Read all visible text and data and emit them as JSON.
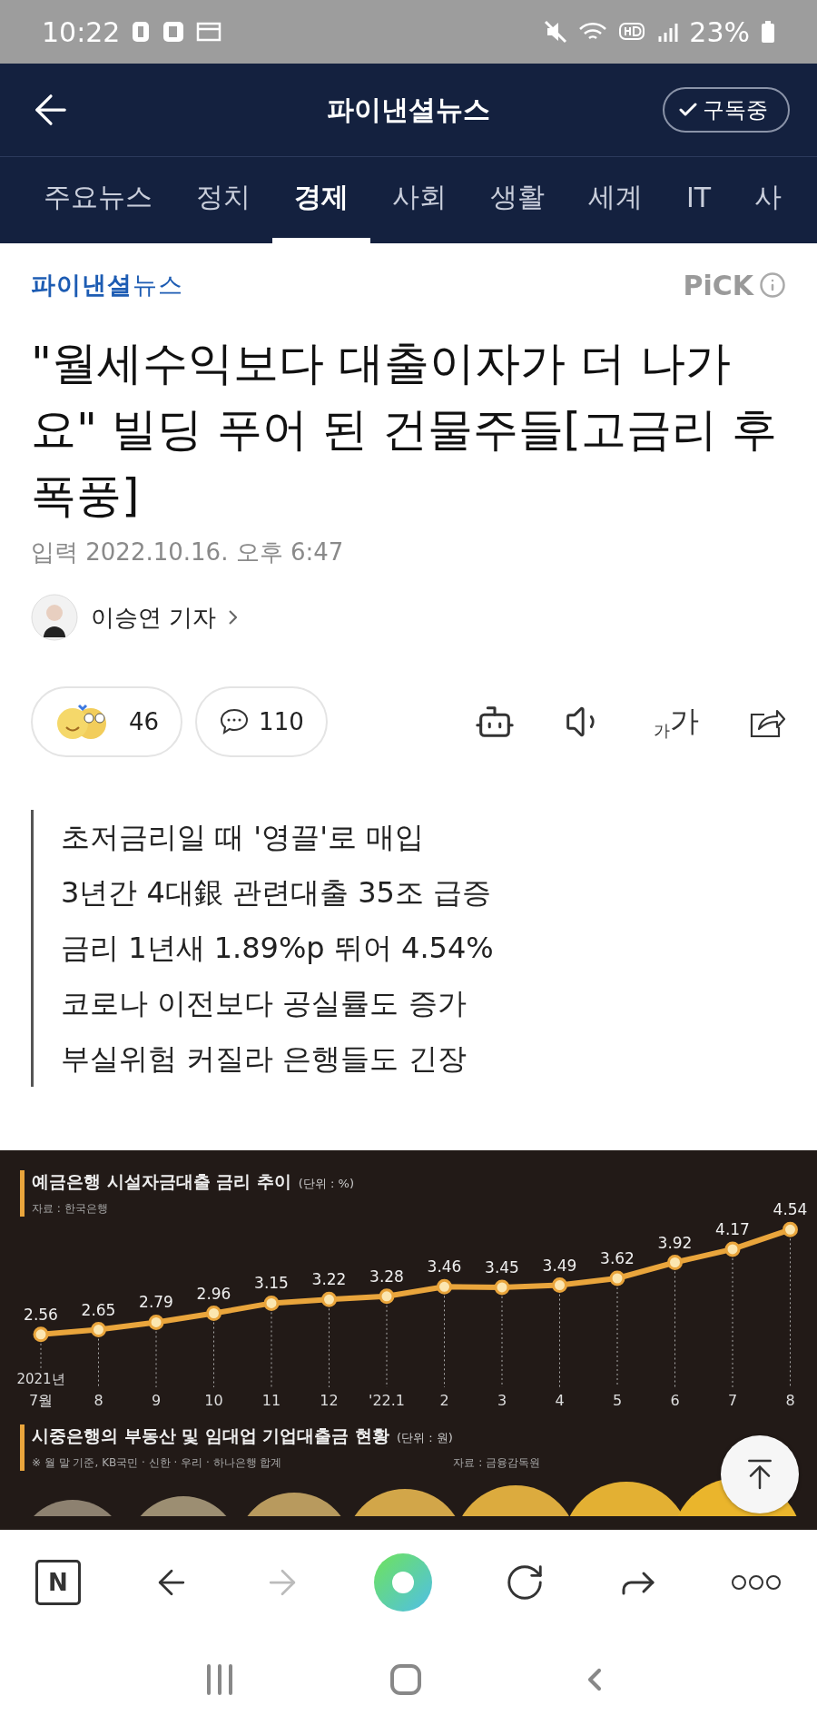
{
  "status_bar": {
    "time": "10:22",
    "battery": "23%"
  },
  "header": {
    "title": "파이낸셜뉴스",
    "subscribe": {
      "label": "구독중",
      "subscribed": true
    }
  },
  "tabs": [
    {
      "label": "주요뉴스",
      "selected": false
    },
    {
      "label": "정치",
      "selected": false
    },
    {
      "label": "경제",
      "selected": true
    },
    {
      "label": "사회",
      "selected": false
    },
    {
      "label": "생활",
      "selected": false
    },
    {
      "label": "세계",
      "selected": false
    },
    {
      "label": "IT",
      "selected": false
    },
    {
      "label": "사",
      "selected": false
    }
  ],
  "article": {
    "press_logo": "**파이낸셜**뉴스",
    "pick": "PiCK",
    "title": "\"월세수익보다 대출이자가 더 나가요\" 빌딩 푸어 된 건물주들[고금리 후폭풍]",
    "date": "입력 2022.10.16. 오후 6:47",
    "author": "이승연 기자",
    "reactions": "46",
    "comments": "110",
    "font_button": [
      "가",
      "가"
    ],
    "summary": [
      "초저금리일 때 '영끌'로 매입",
      "3년간 4대銀 관련대출 35조 급증",
      "금리 1년새 1.89%p 뛰어 4.54%",
      "코로나 이전보다 공실률도 증가",
      "부실위험 커질라 은행들도 긴장"
    ]
  },
  "infographic": {
    "title": "예금은행 시설자금대출 금리 추이",
    "unit": "(단위 : %)",
    "source": "자료 : 한국은행",
    "year_label": "2021년",
    "chart_data": {
      "type": "line",
      "categories": [
        "7월",
        "8",
        "9",
        "10",
        "11",
        "12",
        "'22.1",
        "2",
        "3",
        "4",
        "5",
        "6",
        "7",
        "8"
      ],
      "series": [
        {
          "color": "#e9a53c",
          "marker": "circle",
          "values": [
            2.56,
            2.65,
            2.79,
            2.96,
            3.15,
            3.22,
            3.28,
            3.46,
            3.45,
            3.49,
            3.62,
            3.92,
            4.17,
            4.54
          ]
        }
      ],
      "grid": true,
      "data_labels": true
    },
    "section2": {
      "title": "시중은행의 부동산 및 임대업 기업대출금 현황",
      "unit": "(단위 : 원)",
      "note": "※ 월 말 기준, KB국민 · 신한 · 우리 · 하나은행 합계",
      "source": "자료 : 금융감독원"
    }
  },
  "browser_bar": {
    "home_label": "N",
    "forward_disabled": true
  }
}
